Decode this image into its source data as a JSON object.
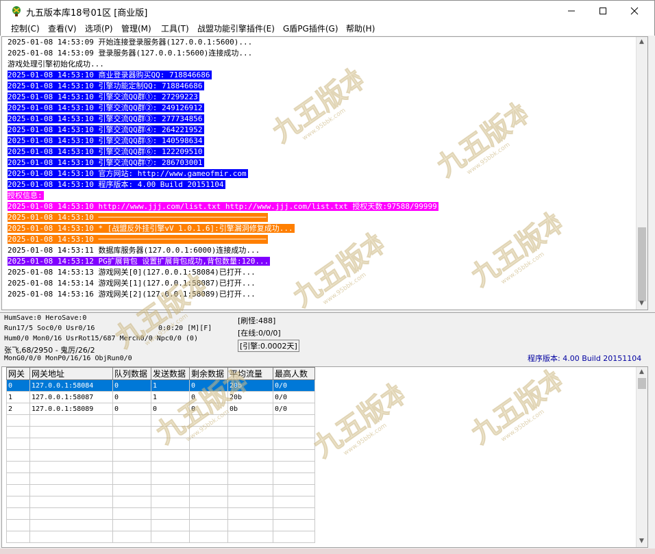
{
  "window": {
    "title": "九五版本库18号01区 [商业版]",
    "minimize_label": "—",
    "maximize_label": "☐",
    "close_label": "✕"
  },
  "menu": {
    "items": [
      {
        "label": "控制(C)"
      },
      {
        "label": "查看(V)"
      },
      {
        "label": "选项(P)"
      },
      {
        "label": "管理(M)"
      },
      {
        "label": "工具(T)"
      },
      {
        "label": "战盟功能引擎插件(E)"
      },
      {
        "label": "G盾PG插件(G)"
      },
      {
        "label": "帮助(H)"
      }
    ]
  },
  "log": {
    "lines": [
      {
        "text": "2025-01-08 14:53:09 开始连接登录服务器(127.0.0.1:5600)..."
      },
      {
        "text": "2025-01-08 14:53:09 登录服务器(127.0.0.1:5600)连接成功..."
      },
      {
        "text": "游戏处理引擎初始化成功..."
      },
      {
        "text": "2025-01-08 14:53:10 商业登录器购买QQ: 718846686"
      },
      {
        "text": "2025-01-08 14:53:10 引擎功能定制QQ: 718846686"
      },
      {
        "text": "2025-01-08 14:53:10 引擎交流QQ群①: 27299223"
      },
      {
        "text": "2025-01-08 14:53:10 引擎交流QQ群②: 249126912"
      },
      {
        "text": "2025-01-08 14:53:10 引擎交流QQ群③: 277734856"
      },
      {
        "text": "2025-01-08 14:53:10 引擎交流QQ群④: 264221952"
      },
      {
        "text": "2025-01-08 14:53:10 引擎交流QQ群⑤: 140598634"
      },
      {
        "text": "2025-01-08 14:53:10 引擎交流QQ群⑥: 122209510"
      },
      {
        "text": "2025-01-08 14:53:10 引擎交流QQ群⑦: 286703001"
      },
      {
        "text": "2025-01-08 14:53:10 官方网站: http://www.gameofmir.com"
      },
      {
        "text": "2025-01-08 14:53:10 程序版本: 4.00 Build 20151104"
      },
      {
        "text": "授权信息:"
      },
      {
        "text": "2025-01-08 14:53:10 http://www.jjj.com/list.txt http://www.jjj.com/list.txt 授权天数:97588/99999"
      },
      {
        "text": "2025-01-08 14:53:10 ─────────────────────────────────────"
      },
      {
        "text": "2025-01-08 14:53:10 * [战盟反外挂引擎vV 1.0.1.6]:引擎漏洞修复成功..."
      },
      {
        "text": "2025-01-08 14:53:10 ─────────────────────────────────────"
      },
      {
        "text": "2025-01-08 14:53:11 数据库服务器(127.0.0.1:6000)连接成功..."
      },
      {
        "text": "2025-01-08 14:53:12 PG扩展背包 设置扩展背包成功,背包数量:120..."
      },
      {
        "text": "2025-01-08 14:53:13 游戏网关[0](127.0.0.1:58084)已打开..."
      },
      {
        "text": "2025-01-08 14:53:14 游戏网关[1](127.0.0.1:58087)已打开..."
      },
      {
        "text": "2025-01-08 14:53:16 游戏网关[2](127.0.0.1:58089)已打开..."
      }
    ]
  },
  "status": {
    "hum_save": "HumSave:0 HeroSave:0",
    "run": "Run17/5 Soc0/0 Usr0/16",
    "timer": "0:0:20 [M][F]",
    "hum": "Hum0/0 Mon0/16 UsrRot15/687 Merch0/0 Npc0/0 (0)",
    "player": "张飞,68/2950 - 鬼厉/26/2",
    "mon": "MonG0/0/0 MonP0/16/16 ObjRun0/0",
    "refresh_monster": "[刷怪:488]",
    "online": "[在线:0/0/0]",
    "engine": "[引擎:0.0002天]",
    "version": "程序版本: 4.00 Build 20151104"
  },
  "gateway_table": {
    "headers": [
      "网关",
      "网关地址",
      "队列数据",
      "发送数据",
      "剩余数据",
      "平均流量",
      "最高人数"
    ],
    "rows": [
      [
        "0",
        "127.0.0.1:58084",
        "0",
        "1",
        "0",
        "20b",
        "0/0"
      ],
      [
        "1",
        "127.0.0.1:58087",
        "0",
        "1",
        "0",
        "20b",
        "0/0"
      ],
      [
        "2",
        "127.0.0.1:58089",
        "0",
        "0",
        "0",
        "0b",
        "0/0"
      ]
    ],
    "selected_row": 0
  },
  "watermark": {
    "text": "九五版本库",
    "subtext": "www.95bbk.com"
  },
  "colors": {
    "blue_highlight": "#0000ff",
    "magenta_highlight": "#ff00ff",
    "orange_highlight": "#ff7f00",
    "purple_highlight": "#8000ff",
    "selection": "#0078d7",
    "version_text": "#0000a0"
  }
}
